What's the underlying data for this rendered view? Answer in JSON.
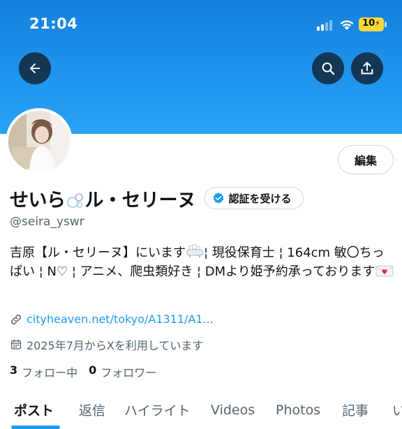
{
  "status_bar": {
    "time": "21:04",
    "battery": "10"
  },
  "nav": {
    "back_icon": "arrow-left-icon",
    "search_icon": "search-icon",
    "share_icon": "share-icon"
  },
  "profile": {
    "display_name_part1": "せいら",
    "display_name_part2": "ル・セリーヌ",
    "handle": "@seira_yswr",
    "edit_label": "編集",
    "verify_label": "認証を受ける",
    "bio_part1": "吉原【ル・セリーヌ】にいます",
    "bio_part2": "¦ 現役保育士 ¦ 164cm 敏〇ちっぱい ¦ N♡ ¦ アニメ、爬虫類好き ¦ DMより姫予約承っております",
    "link": "cityheaven.net/tokyo/A1311/A1...",
    "joined": "2025年7月からXを利用しています",
    "following_count": "3",
    "following_label": "フォロー中",
    "followers_count": "0",
    "followers_label": "フォロワー"
  },
  "tabs": [
    {
      "label": "ポスト"
    },
    {
      "label": "返信"
    },
    {
      "label": "ハイライト"
    },
    {
      "label": "Videos"
    },
    {
      "label": "Photos"
    },
    {
      "label": "記事"
    },
    {
      "label": "い"
    }
  ],
  "colors": {
    "accent": "#1d9bf0",
    "banner": "#1f95ee",
    "text": "#0f1419",
    "muted": "#536471"
  }
}
